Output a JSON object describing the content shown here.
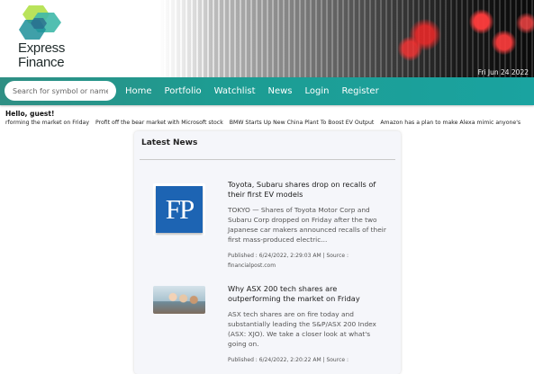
{
  "header": {
    "logo_line1": "Express",
    "logo_line2": "Finance",
    "date": "Fri Jun 24 2022"
  },
  "navbar": {
    "search_placeholder": "Search for symbol or name",
    "links": [
      "Home",
      "Portfolio",
      "Watchlist",
      "News",
      "Login",
      "Register"
    ]
  },
  "greeting": "Hello, guest!",
  "ticker": [
    "rforming the market on Friday",
    "Profit off the bear market with Microsoft stock",
    "BMW Starts Up New China Plant To Boost EV Output",
    "Amazon has a plan to make Alexa mimic anyone's"
  ],
  "news": {
    "title": "Latest News",
    "items": [
      {
        "thumb": "financial-post-logo",
        "thumb_text": "FP",
        "title": "Toyota, Subaru shares drop on recalls of their first EV models",
        "summary": "TOKYO — Shares of Toyota Motor Corp and Subaru Corp dropped on Friday after the two Japanese car makers announced recalls of their first mass-produced electric...",
        "meta": "Published : 6/24/2022, 2:29:03 AM | Source : financialpost.com"
      },
      {
        "thumb": "office-photo",
        "title": "Why ASX 200 tech shares are outperforming the market on Friday",
        "summary": "ASX tech shares are on fire today and substantially leading the S&P/ASX 200 Index (ASX: XJO). We take a closer look at what's going on.",
        "meta": "Published : 6/24/2022, 2:20:22 AM | Source :"
      }
    ]
  },
  "colors": {
    "nav_bar": "#1d9c92",
    "fp_blue": "#1d64b3",
    "logo_green": "#6cc24a",
    "logo_teal": "#1f9e9a"
  }
}
